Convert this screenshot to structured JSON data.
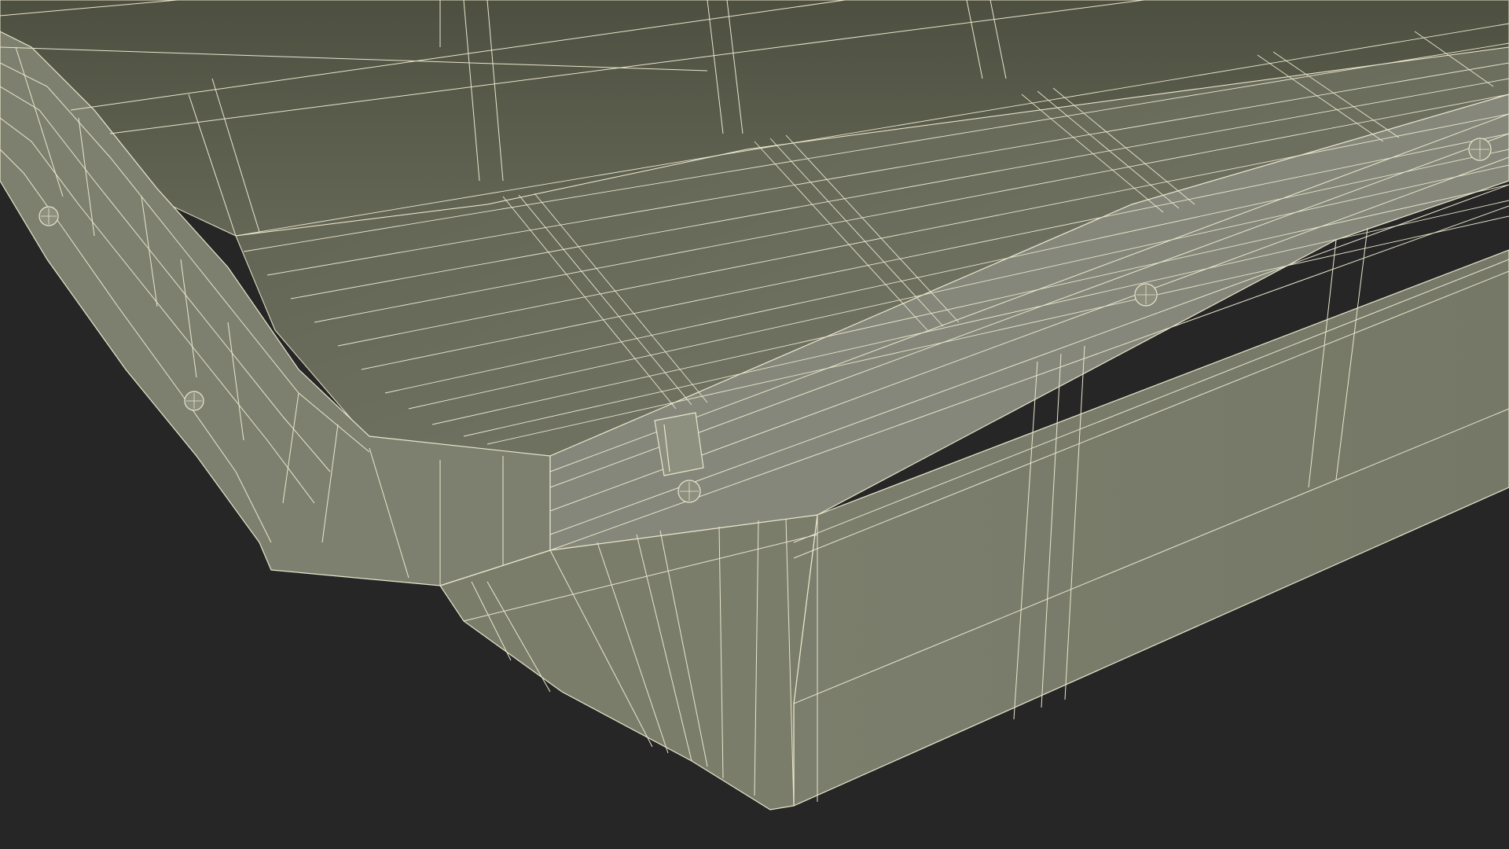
{
  "scene": {
    "subject": "wireframe-render",
    "colors": {
      "background": "#262626",
      "surface_outer": "#7b7d6b",
      "surface_inner": "#5f6152",
      "surface_rim": "#86887a",
      "wire": "#e9e6cc"
    },
    "icons": [
      "fastener-icon",
      "tab-clip-icon"
    ]
  }
}
